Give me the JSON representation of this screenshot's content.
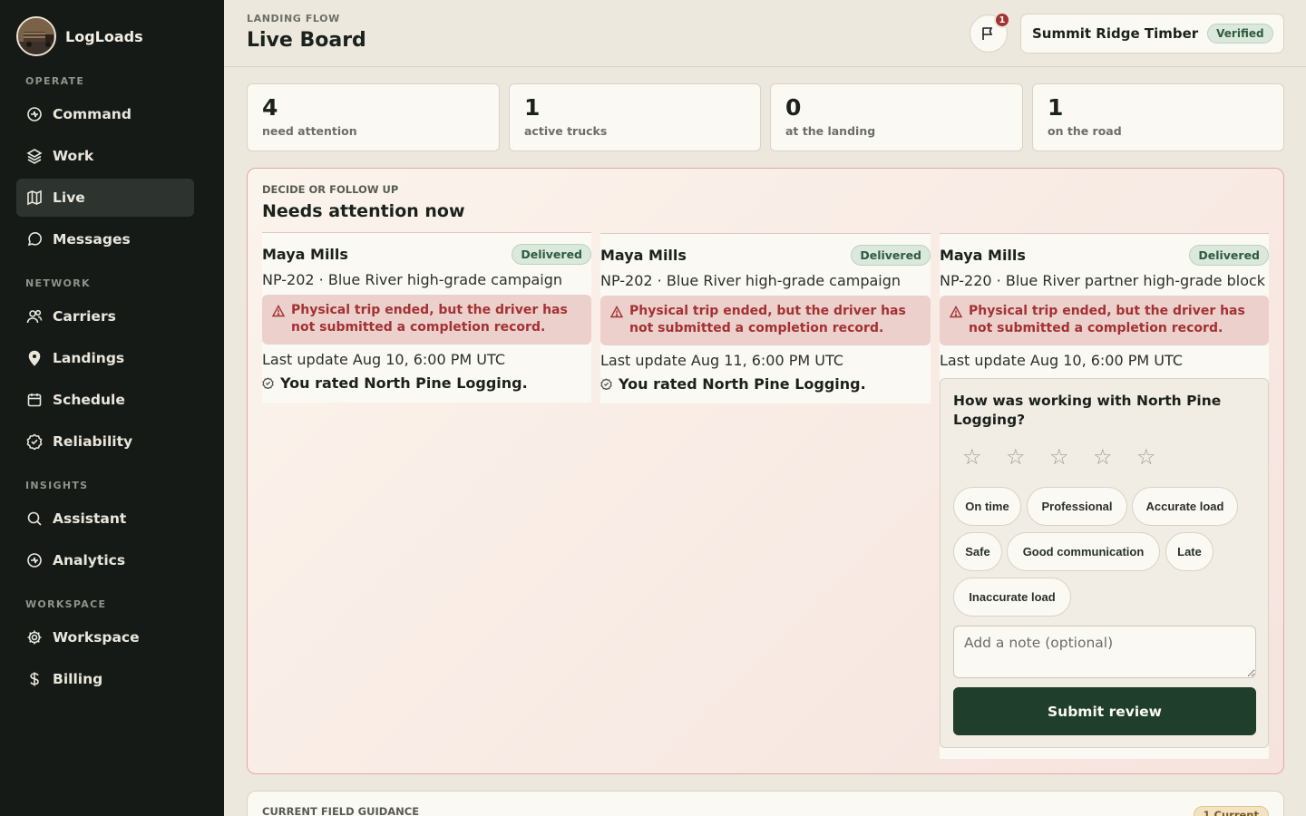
{
  "app": {
    "name": "LogLoads"
  },
  "sidebar": {
    "sections": [
      {
        "title": "OPERATE",
        "items": [
          {
            "label": "Command",
            "icon": "command-icon"
          },
          {
            "label": "Work",
            "icon": "layers-icon"
          },
          {
            "label": "Live",
            "icon": "map-icon",
            "active": true
          },
          {
            "label": "Messages",
            "icon": "message-icon"
          }
        ]
      },
      {
        "title": "NETWORK",
        "items": [
          {
            "label": "Carriers",
            "icon": "users-icon"
          },
          {
            "label": "Landings",
            "icon": "location-pin-icon"
          },
          {
            "label": "Schedule",
            "icon": "calendar-icon"
          },
          {
            "label": "Reliability",
            "icon": "badge-check-icon"
          }
        ]
      },
      {
        "title": "INSIGHTS",
        "items": [
          {
            "label": "Assistant",
            "icon": "search-icon"
          },
          {
            "label": "Analytics",
            "icon": "analytics-icon"
          }
        ]
      },
      {
        "title": "WORKSPACE",
        "items": [
          {
            "label": "Workspace",
            "icon": "gear-icon"
          },
          {
            "label": "Billing",
            "icon": "dollar-icon"
          }
        ]
      }
    ]
  },
  "header": {
    "eyebrow": "LANDING FLOW",
    "title": "Live Board",
    "notification_count": "1",
    "org_name": "Summit Ridge Timber",
    "org_status": "Verified"
  },
  "stats": [
    {
      "value": "4",
      "label": "need attention"
    },
    {
      "value": "1",
      "label": "active trucks"
    },
    {
      "value": "0",
      "label": "at the landing"
    },
    {
      "value": "1",
      "label": "on the road"
    }
  ],
  "attention": {
    "eyebrow": "DECIDE OR FOLLOW UP",
    "title": "Needs attention now",
    "cards": [
      {
        "name": "Maya Mills",
        "status": "Delivered",
        "job": "NP-202 · Blue River high-grade campaign",
        "alert": "Physical trip ended, but the driver has not submitted a completion record.",
        "update": "Last update Aug 10, 6:00 PM UTC",
        "rated": "You rated North Pine Logging."
      },
      {
        "name": "Maya Mills",
        "status": "Delivered",
        "job": "NP-202 · Blue River high-grade campaign",
        "alert": "Physical trip ended, but the driver has not submitted a completion record.",
        "update": "Last update Aug 11, 6:00 PM UTC",
        "rated": "You rated North Pine Logging."
      },
      {
        "name": "Maya Mills",
        "status": "Delivered",
        "job": "NP-220 · Blue River partner high-grade block",
        "alert": "Physical trip ended, but the driver has not submitted a completion record.",
        "update": "Last update Aug 10, 6:00 PM UTC"
      }
    ],
    "review": {
      "question": "How was working with North Pine Logging?",
      "rating": 0,
      "max_rating": 5,
      "tags": [
        "On time",
        "Professional",
        "Accurate load",
        "Safe",
        "Good communication",
        "Late",
        "Inaccurate load"
      ],
      "note_placeholder": "Add a note (optional)",
      "submit_label": "Submit review"
    }
  },
  "guidance": {
    "eyebrow": "CURRENT FIELD GUIDANCE",
    "badge": "1 Current"
  },
  "colors": {
    "sidebar_bg": "#151a16",
    "page_bg": "#ede8dd",
    "alert_text": "#a33232",
    "alert_bg": "#ecd0cc",
    "success": "#2f5b41",
    "primary_button": "#1f3f2c"
  }
}
